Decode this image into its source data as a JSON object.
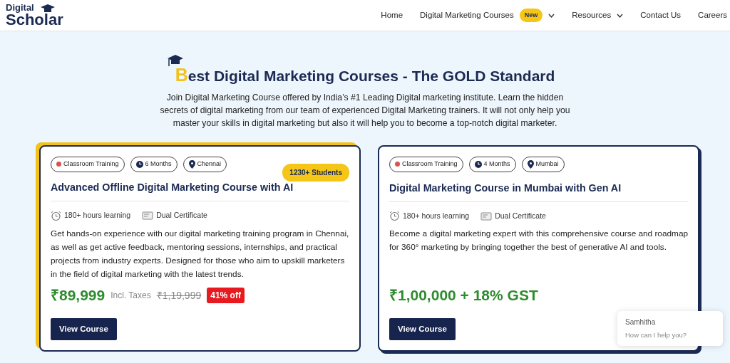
{
  "logo": {
    "line_1": "Digital",
    "line_2": "Scholar"
  },
  "nav": [
    {
      "label": "Home",
      "dropdown": false
    },
    {
      "label": "Digital Marketing Courses",
      "badge": "New",
      "dropdown": true
    },
    {
      "label": "Resources",
      "dropdown": true
    },
    {
      "label": "Contact Us",
      "dropdown": false
    },
    {
      "label": "Careers",
      "dropdown": false
    }
  ],
  "hero": {
    "title": "Best Digital Marketing Courses - The GOLD Standard",
    "intro": "Join Digital Marketing Course offered by India’s #1 Leading Digital marketing institute. Learn the hidden secrets of digital marketing from our team of experienced Digital Marketing trainers. It will not only help you master your skills in digital marketing but also it will help you to become a top-notch digital marketer."
  },
  "courses": [
    {
      "featured": true,
      "chips": [
        {
          "kind": "dot",
          "label": "Classroom Training"
        },
        {
          "kind": "clock",
          "label": "6 Months"
        },
        {
          "kind": "pin",
          "label": "Chennai"
        }
      ],
      "students": "1230+ Students",
      "title": "Advanced Offline Digital Marketing Course with AI",
      "features": [
        {
          "kind": "alarm",
          "label": "180+ hours learning"
        },
        {
          "kind": "certificate",
          "label": "Dual Certificate"
        }
      ],
      "description": "Get hands-on experience with our digital marketing training program in Chennai, as well as get active feedback, mentoring sessions, internships, and practical projects from industry experts. Designed for those who aim to upskill marketers in the field of digital marketing with the latest trends.",
      "price": "₹89,999",
      "price_note": "Incl. Taxes",
      "old_price": "₹1,19,999",
      "discount": "41% off",
      "button": "View Course"
    },
    {
      "featured": false,
      "chips": [
        {
          "kind": "dot",
          "label": "Classroom Training"
        },
        {
          "kind": "clock",
          "label": "4 Months"
        },
        {
          "kind": "pin",
          "label": "Mumbai"
        }
      ],
      "title": "Digital Marketing Course in Mumbai with Gen AI",
      "features": [
        {
          "kind": "alarm",
          "label": "180+ hours learning"
        },
        {
          "kind": "certificate",
          "label": "Dual Certificate"
        }
      ],
      "description": "Become a digital marketing expert with this comprehensive course and roadmap for 360° marketing by bringing together the best of generative AI and tools.",
      "price": "₹1,00,000 + 18% GST",
      "button": "View Course"
    }
  ],
  "chat": {
    "name": "Samhitha",
    "message": "How can I help you?"
  }
}
